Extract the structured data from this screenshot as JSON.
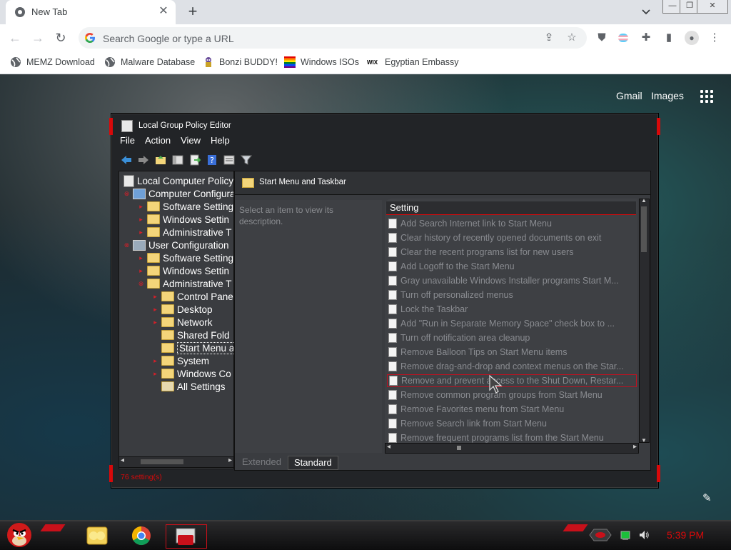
{
  "browser": {
    "tab_title": "New Tab",
    "tab_close": "✕",
    "new_tab": "+",
    "omnibox_placeholder": "Search Google or type a URL",
    "window_controls": [
      "—",
      "❐",
      "✕"
    ],
    "bookmarks": [
      {
        "label": "MEMZ Download",
        "icon": "globe-icon"
      },
      {
        "label": "Malware Database",
        "icon": "globe-icon"
      },
      {
        "label": "Bonzi BUDDY!",
        "icon": "bonzi-icon"
      },
      {
        "label": "Windows ISOs",
        "icon": "windows-flag-icon"
      },
      {
        "label": "Egyptian Embassy",
        "icon": "wix-icon"
      }
    ],
    "wix_text": "WIX"
  },
  "page": {
    "gmail": "Gmail",
    "images": "Images"
  },
  "gpedit": {
    "title": "Local Group Policy Editor",
    "menu": [
      "File",
      "Action",
      "View",
      "Help"
    ],
    "tree": [
      {
        "label": "Local Computer Policy",
        "depth": 0
      },
      {
        "label": "Computer Configura",
        "depth": 0
      },
      {
        "label": "Software Setting",
        "depth": 1
      },
      {
        "label": "Windows Settin",
        "depth": 1
      },
      {
        "label": "Administrative T",
        "depth": 1
      },
      {
        "label": "User Configuration",
        "depth": 0
      },
      {
        "label": "Software Setting",
        "depth": 1
      },
      {
        "label": "Windows Settin",
        "depth": 1
      },
      {
        "label": "Administrative T",
        "depth": 1
      },
      {
        "label": "Control Pane",
        "depth": 2
      },
      {
        "label": "Desktop",
        "depth": 2
      },
      {
        "label": "Network",
        "depth": 2
      },
      {
        "label": "Shared Fold",
        "depth": 2
      },
      {
        "label": "Start Menu a",
        "depth": 2
      },
      {
        "label": "System",
        "depth": 2
      },
      {
        "label": "Windows Co",
        "depth": 2
      },
      {
        "label": "All Settings",
        "depth": 2
      }
    ],
    "header_title": "Start Menu and Taskbar",
    "description_prompt": "Select an item to view its description.",
    "column_header": "Setting",
    "settings": [
      "Add Search Internet link to Start Menu",
      "Clear history of recently opened documents on exit",
      "Clear the recent programs list for new users",
      "Add Logoff to the Start Menu",
      "Gray unavailable Windows Installer programs Start M...",
      "Turn off personalized menus",
      "Lock the Taskbar",
      "Add \"Run in Separate Memory Space\" check box to ...",
      "Turn off notification area cleanup",
      "Remove Balloon Tips on Start Menu items",
      "Remove drag-and-drop and context menus on the Star...",
      "Remove and prevent access to the Shut Down, Restar...",
      "Remove common program groups from Start Menu",
      "Remove Favorites menu from Start Menu",
      "Remove Search link from Start Menu",
      "Remove frequent programs list from the Start Menu"
    ],
    "selected_setting_index": 11,
    "tabs": [
      "Extended",
      "Standard"
    ],
    "active_tab": "Standard",
    "status": "76 setting(s)"
  },
  "taskbar": {
    "clock": "5:39 PM",
    "apps": [
      "explorer-icon",
      "chrome-icon",
      "gpedit-icon"
    ]
  },
  "colors": {
    "accent_red": "#d8090a",
    "window_bg": "#222427",
    "pane_bg": "#3a3c40"
  }
}
